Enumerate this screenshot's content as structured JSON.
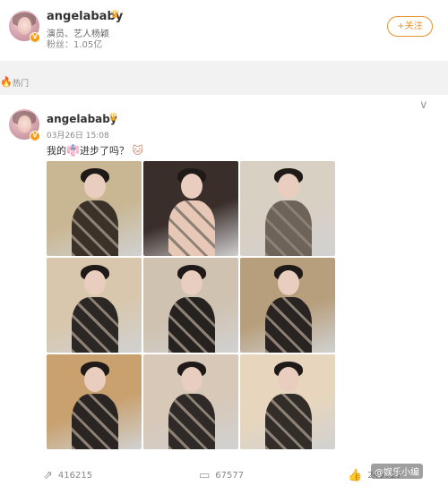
{
  "profile": {
    "name": "angelababy",
    "description": "演员、艺人杨颖",
    "fans": "粉丝：1.05亿",
    "follow_label": "+关注",
    "crown_icon": "crown-icon"
  },
  "section": {
    "label": "热门",
    "icon": "fire-icon"
  },
  "post": {
    "author": "angelababy",
    "time": "03月26日 15:08",
    "text_prefix": "我的",
    "text_suffix": "进步了吗？",
    "images": [
      {
        "bg": "#c9b793",
        "accent": "#3a3128"
      },
      {
        "bg": "#3a2e2a",
        "accent": "#e7c7b6"
      },
      {
        "bg": "#d9d0c4",
        "accent": "#6d6358"
      },
      {
        "bg": "#d8c7ad",
        "accent": "#2b2724"
      },
      {
        "bg": "#cfc2b0",
        "accent": "#262220"
      },
      {
        "bg": "#b79e7c",
        "accent": "#292422"
      },
      {
        "bg": "#c8a16f",
        "accent": "#2a2422"
      },
      {
        "bg": "#d7c8b8",
        "accent": "#2f2927"
      },
      {
        "bg": "#e7d6bd",
        "accent": "#332d2a"
      }
    ]
  },
  "actions": {
    "repost_count": "416215",
    "comment_count": "67577",
    "like_count": "249727",
    "watermark": "@娱乐小编"
  },
  "colors": {
    "accent": "#e8932c",
    "crown": "#f6a623"
  }
}
